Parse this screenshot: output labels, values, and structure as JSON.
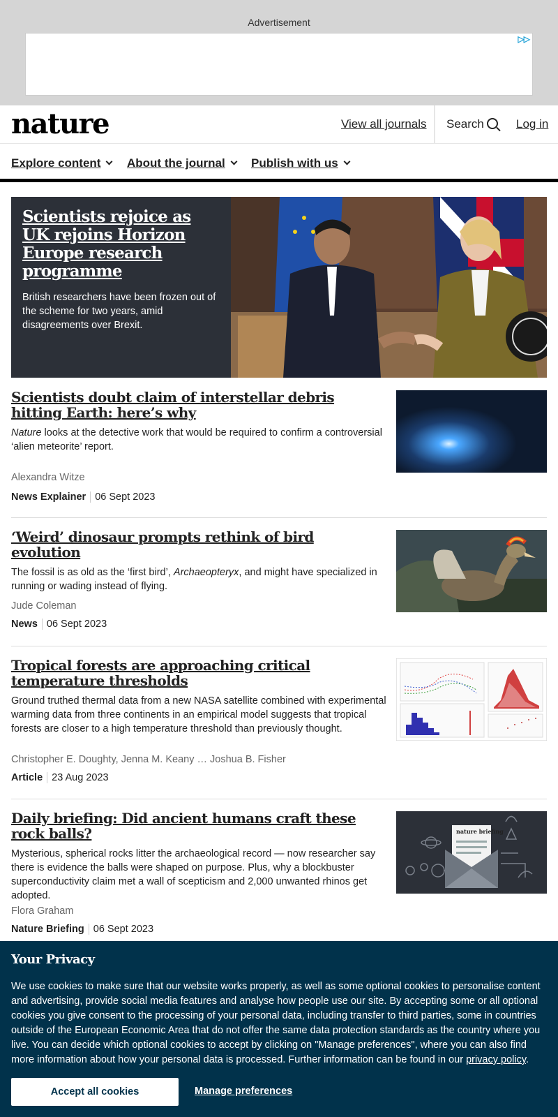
{
  "ad": {
    "label": "Advertisement"
  },
  "header": {
    "logo": "nature",
    "view_all_journals": "View all journals",
    "search": "Search",
    "login": "Log in"
  },
  "nav": {
    "items": [
      {
        "label": "Explore content"
      },
      {
        "label": "About the journal"
      },
      {
        "label": "Publish with us"
      }
    ]
  },
  "hero": {
    "title": "Scientists rejoice as UK rejoins Horizon Europe research programme",
    "description": "British researchers have been frozen out of the scheme for two years, amid disagreements over Brexit."
  },
  "articles": [
    {
      "title": "Scientists doubt claim of interstellar debris hitting Earth: here’s why",
      "desc_italic": "Nature",
      "description": " looks at the detective work that would be required to confirm a controversial ‘alien meteorite’ report.",
      "authors": "Alexandra Witze",
      "type": "News Explainer",
      "date": "06 Sept 2023"
    },
    {
      "title": "‘Weird’ dinosaur prompts rethink of bird evolution",
      "desc_pre": "The fossil is as old as the ‘first bird’, ",
      "desc_italic": "Archaeopteryx",
      "desc_post": ", and might have specialized in running or wading instead of flying.",
      "authors": "Jude Coleman",
      "type": "News",
      "date": "06 Sept 2023"
    },
    {
      "title": "Tropical forests are approaching critical temperature thresholds",
      "description": "Ground truthed thermal data from a new NASA satellite combined with experimental warming data from three continents in an empirical model suggests that tropical forests are closer to a high temperature threshold than previously thought.",
      "authors": "Christopher E. Doughty, Jenna M. Keany … Joshua B. Fisher",
      "type": "Article",
      "date": "23 Aug 2023"
    },
    {
      "title": "Daily briefing: Did ancient humans craft these rock balls?",
      "description": "Mysterious, spherical rocks litter the archaeological record — now researcher say there is evidence the balls were shaped on purpose. Plus, why a blockbuster superconductivity claim met a wall of scepticism and 2,000 unwanted rhinos get adopted.",
      "authors": "Flora Graham",
      "type": "Nature Briefing",
      "date": "06 Sept 2023",
      "image_text": "nature briefing"
    }
  ],
  "privacy": {
    "title": "Your Privacy",
    "text": "We use cookies to make sure that our website works properly, as well as some optional cookies to personalise content and advertising, provide social media features and analyse how people use our site. By accepting some or all optional cookies you give consent to the processing of your personal data, including transfer to third parties, some in countries outside of the European Economic Area that do not offer the same data protection standards as the country where you live. You can decide which optional cookies to accept by clicking on \"Manage preferences\", where you can also find more information about how your personal data is processed. Further information can be found in our ",
    "link": "privacy policy",
    "end": ".",
    "accept": "Accept all cookies",
    "manage": "Manage preferences"
  }
}
